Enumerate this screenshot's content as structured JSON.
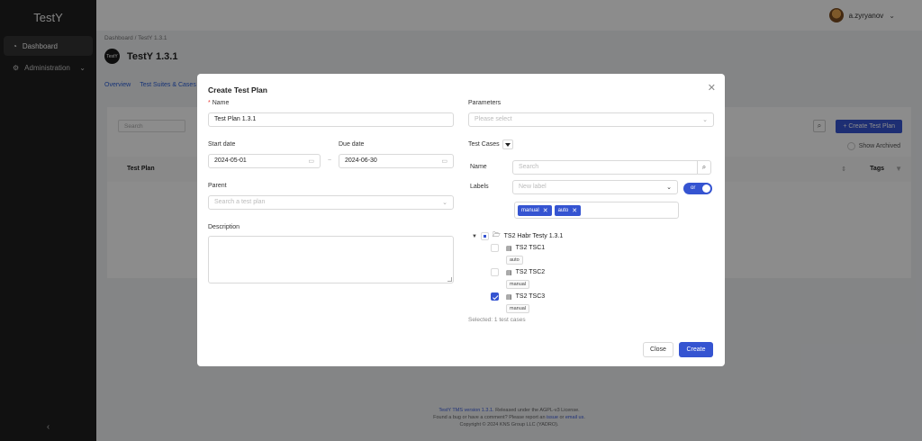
{
  "app": {
    "logo": "TestY"
  },
  "sidebar": {
    "items": [
      {
        "label": "Dashboard",
        "icon": "dashboard-icon"
      },
      {
        "label": "Administration",
        "icon": "gear-icon"
      }
    ],
    "collapse_glyph": "‹"
  },
  "header": {
    "username": "a.zyryanov"
  },
  "page": {
    "breadcrumb": "Dashboard / TestY 1.3.1",
    "project_logo": "TestY",
    "project_title": "TestY 1.3.1",
    "tabs": [
      "Overview",
      "Test Suites & Cases"
    ],
    "search_placeholder": "Search",
    "create_button": "+ Create Test Plan",
    "show_archived": "Show Archived",
    "table": {
      "col_plan": "Test Plan",
      "col_tags": "Tags"
    },
    "footer": {
      "line1_link": "TestY TMS version 1.3.1.",
      "line1_rest": " Released under the AGPL-v3 License.",
      "line2_pre": "Found a bug or have a comment?  Please report an ",
      "line2_issue": "issue",
      "line2_mid": " or ",
      "line2_email": "email us",
      "line2_post": ".",
      "line3": "Copyright © 2024 KNS Group LLC (YADRO)."
    }
  },
  "modal": {
    "title": "Create Test Plan",
    "close_glyph": "✕",
    "name": {
      "label": "Name",
      "value": "Test Plan 1.3.1"
    },
    "start_date": {
      "label": "Start date",
      "value": "2024-05-01"
    },
    "due_date": {
      "label": "Due date",
      "value": "2024-06-30"
    },
    "parent": {
      "label": "Parent",
      "placeholder": "Search a test plan"
    },
    "description": {
      "label": "Description"
    },
    "parameters": {
      "label": "Parameters",
      "placeholder": "Please select"
    },
    "test_cases": {
      "label": "Test Cases",
      "name_label": "Name",
      "name_placeholder": "Search",
      "labels_label": "Labels",
      "labels_placeholder": "New label",
      "toggle_label": "or",
      "selected_labels": [
        "manual",
        "auto"
      ],
      "tree": {
        "root": "TS2 Habr Testy 1.3.1",
        "cases": [
          {
            "name": "TS2 TSC1",
            "tag": "auto",
            "checked": false
          },
          {
            "name": "TS2 TSC2",
            "tag": "manual",
            "checked": false
          },
          {
            "name": "TS2 TSC3",
            "tag": "manual",
            "checked": true
          }
        ]
      },
      "selected_text": "Selected: 1 test cases"
    },
    "buttons": {
      "close": "Close",
      "create": "Create"
    }
  },
  "colors": {
    "primary": "#3554d1",
    "sidebar": "#1f1f1f",
    "required": "#e53935"
  }
}
